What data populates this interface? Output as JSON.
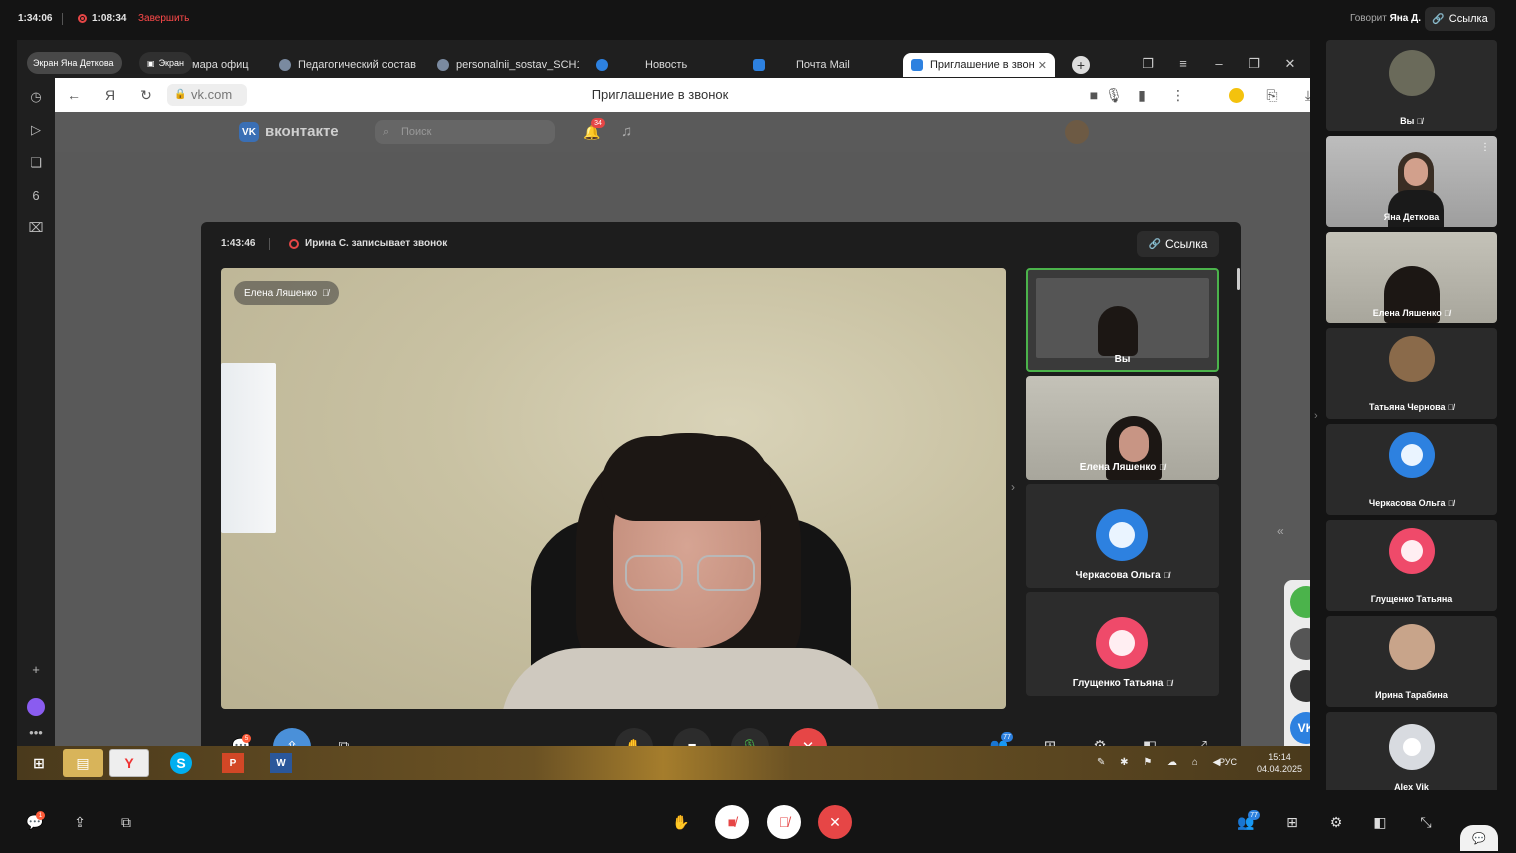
{
  "outer_header": {
    "call_time": "1:34:06",
    "recording_time": "1:08:34",
    "finish_label": "Завершить",
    "speaking_prefix": "Говорит",
    "speaking_name": "Яна Д.",
    "link_label": "Ссылка"
  },
  "screen_share": {
    "presenter_pill": "Экран Яна Деткова",
    "screen_pill": "Экран"
  },
  "browser": {
    "tabs": [
      {
        "label": "мара офиц"
      },
      {
        "label": "Педагогический состав"
      },
      {
        "label": "personalnii_sostav_SCH1"
      },
      {
        "label": "Новость"
      },
      {
        "label": "Почта Mail"
      },
      {
        "label": "Приглашение в звонок"
      }
    ],
    "url": "vk.com",
    "page_title": "Приглашение в звонок"
  },
  "vk": {
    "brand": "вконтакте",
    "search_placeholder": "Поиск",
    "notif_count": "34"
  },
  "call": {
    "time": "1:43:46",
    "recording_text": "Ирина С. записывает звонок",
    "link_label": "Ссылка",
    "main_speaker": "Елена Ляшенко",
    "tiles": [
      {
        "name": "Вы"
      },
      {
        "name": "Елена Ляшенко"
      },
      {
        "name": "Черкасова Ольга"
      },
      {
        "name": "Глущенко Татьяна"
      }
    ],
    "participants_badge": "77",
    "chat_badge": "5"
  },
  "taskbar": {
    "lang": "РУС",
    "time": "15:14",
    "date": "04.04.2025"
  },
  "right_participants": [
    {
      "name": "Вы"
    },
    {
      "name": "Яна Деткова"
    },
    {
      "name": "Елена Ляшенко"
    },
    {
      "name": "Татьяна Чернова"
    },
    {
      "name": "Черкасова Ольга"
    },
    {
      "name": "Глущенко Татьяна"
    },
    {
      "name": "Ирина Тарабина"
    },
    {
      "name": "Alex Vik"
    }
  ],
  "bottom_bar": {
    "participants_badge": "77",
    "chat_badge": "1"
  }
}
